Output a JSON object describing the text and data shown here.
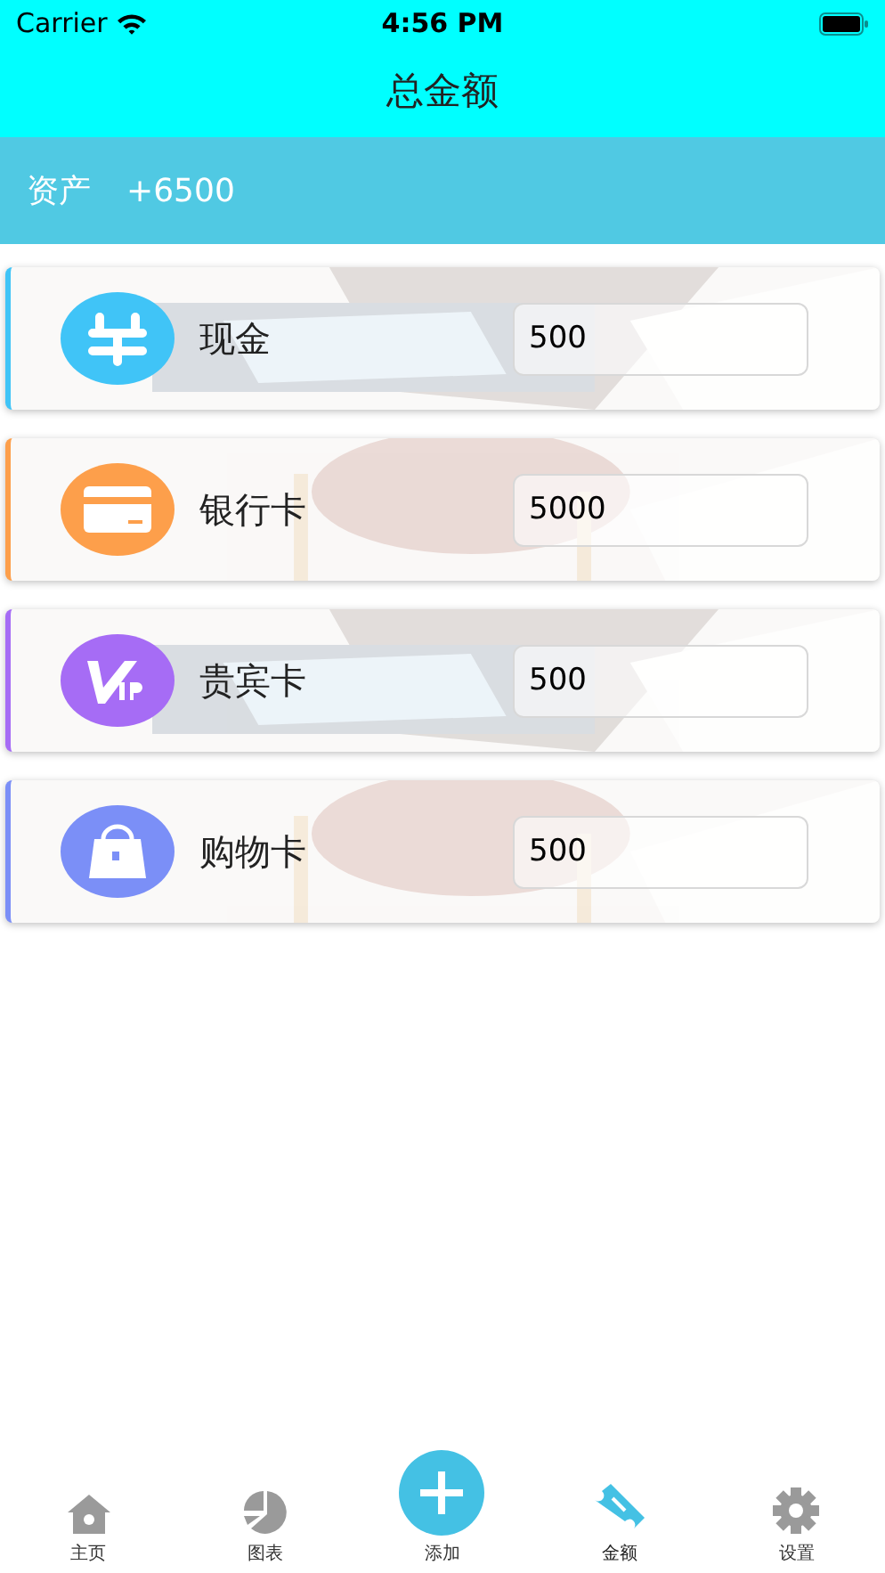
{
  "status_bar": {
    "carrier": "Carrier",
    "time": "4:56 PM"
  },
  "nav": {
    "title": "总金额"
  },
  "summary": {
    "label": "资产",
    "value": "+6500"
  },
  "accounts": [
    {
      "kind": "cash",
      "name": "现金",
      "value": "500",
      "color": "#40c4f7"
    },
    {
      "kind": "bank",
      "name": "银行卡",
      "value": "5000",
      "color": "#fd9f4b"
    },
    {
      "kind": "vip",
      "name": "贵宾卡",
      "value": "500",
      "color": "#a66cf5"
    },
    {
      "kind": "shopping",
      "name": "购物卡",
      "value": "500",
      "color": "#7b8ff7"
    }
  ],
  "tabs": [
    {
      "kind": "home",
      "label": "主页",
      "selected": false
    },
    {
      "kind": "chart",
      "label": "图表",
      "selected": false
    },
    {
      "kind": "add",
      "label": "添加",
      "selected": false
    },
    {
      "kind": "ticket",
      "label": "金额",
      "selected": true
    },
    {
      "kind": "settings",
      "label": "设置",
      "selected": false
    }
  ]
}
